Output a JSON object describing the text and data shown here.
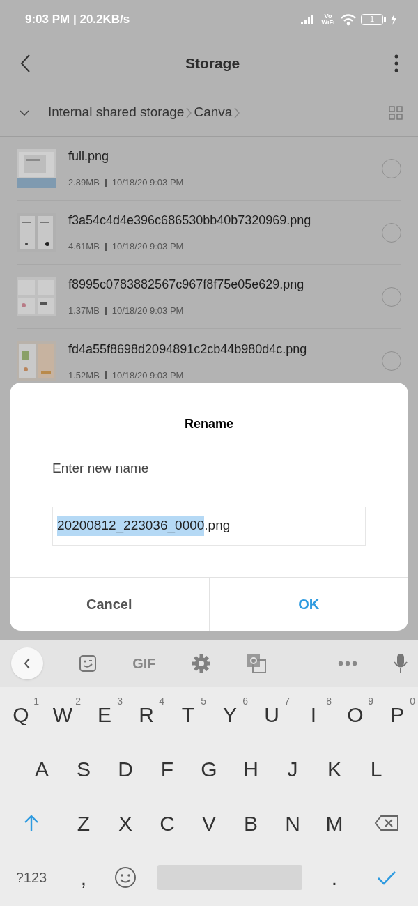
{
  "status_bar": {
    "time_speed": "9:03 PM | 20.2KB/s",
    "network_label": "Vo WiFi",
    "battery": "1"
  },
  "app_bar": {
    "title": "Storage"
  },
  "breadcrumb": {
    "items": [
      "Internal shared storage",
      "Canva"
    ]
  },
  "files": [
    {
      "name": "full.png",
      "size": "2.89MB",
      "date": "10/18/20 9:03 PM",
      "selected": false
    },
    {
      "name": "f3a54c4d4e396c686530bb40b7320969.png",
      "size": "4.61MB",
      "date": "10/18/20 9:03 PM",
      "selected": false
    },
    {
      "name": "f8995c0783882567c967f8f75e05e629.png",
      "size": "1.37MB",
      "date": "10/18/20 9:03 PM",
      "selected": false
    },
    {
      "name": "fd4a55f8698d2094891c2cb44b980d4c.png",
      "size": "1.52MB",
      "date": "10/18/20 9:03 PM",
      "selected": false
    }
  ],
  "dialog": {
    "title": "Rename",
    "prompt": "Enter new name",
    "field": [
      {
        "text": "20200812_223036_0000",
        "selected": true
      },
      {
        "text": ".png",
        "selected": false
      }
    ],
    "buttons": [
      {
        "label": "Cancel",
        "kind": "cancel"
      },
      {
        "label": "OK",
        "kind": "ok"
      }
    ]
  },
  "keyboard": {
    "toolbar": [
      {
        "kind": "back"
      },
      {
        "kind": "sticker"
      },
      {
        "kind": "gif",
        "label": "GIF"
      },
      {
        "kind": "settings"
      },
      {
        "kind": "translate"
      },
      {
        "kind": "divider"
      },
      {
        "kind": "more"
      },
      {
        "kind": "mic"
      }
    ],
    "rows": [
      [
        {
          "label": "Q",
          "hint": "1"
        },
        {
          "label": "W",
          "hint": "2"
        },
        {
          "label": "E",
          "hint": "3"
        },
        {
          "label": "R",
          "hint": "4"
        },
        {
          "label": "T",
          "hint": "5"
        },
        {
          "label": "Y",
          "hint": "6"
        },
        {
          "label": "U",
          "hint": "7"
        },
        {
          "label": "I",
          "hint": "8"
        },
        {
          "label": "O",
          "hint": "9"
        },
        {
          "label": "P",
          "hint": "0"
        }
      ],
      [
        {
          "label": "A"
        },
        {
          "label": "S"
        },
        {
          "label": "D"
        },
        {
          "label": "F"
        },
        {
          "label": "G"
        },
        {
          "label": "H"
        },
        {
          "label": "J"
        },
        {
          "label": "K"
        },
        {
          "label": "L"
        }
      ],
      [
        {
          "kind": "shift"
        },
        {
          "label": "Z"
        },
        {
          "label": "X"
        },
        {
          "label": "C"
        },
        {
          "label": "V"
        },
        {
          "label": "B"
        },
        {
          "label": "N"
        },
        {
          "label": "M"
        },
        {
          "kind": "backspace"
        }
      ]
    ],
    "bottom_row": [
      {
        "kind": "symbols",
        "label": "?123"
      },
      {
        "label": ","
      },
      {
        "kind": "emoji"
      },
      {
        "kind": "space"
      },
      {
        "label": "."
      },
      {
        "kind": "enter"
      }
    ]
  }
}
